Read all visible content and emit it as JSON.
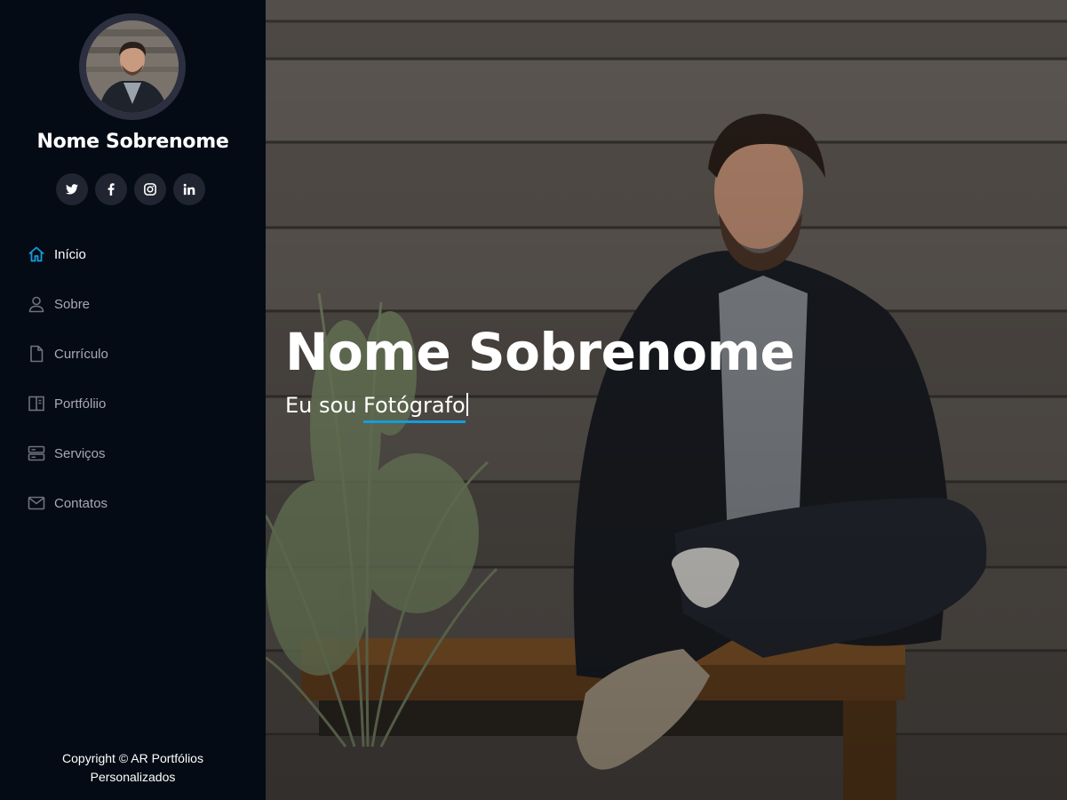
{
  "profile": {
    "name": "Nome Sobrenome"
  },
  "social": [
    {
      "icon": "twitter-icon"
    },
    {
      "icon": "facebook-icon"
    },
    {
      "icon": "instagram-icon"
    },
    {
      "icon": "linkedin-icon"
    }
  ],
  "nav": {
    "items": [
      {
        "label": "Início",
        "icon": "home-icon",
        "active": true
      },
      {
        "label": "Sobre",
        "icon": "person-icon"
      },
      {
        "label": "Currículo",
        "icon": "file-icon"
      },
      {
        "label": "Portfóliio",
        "icon": "book-half-icon"
      },
      {
        "label": "Serviços",
        "icon": "server-icon"
      },
      {
        "label": "Contatos",
        "icon": "envelope-icon"
      }
    ]
  },
  "footer": {
    "line1": "Copyright © AR Portfólios",
    "line2": "Personalizados"
  },
  "hero": {
    "title": "Nome Sobrenome",
    "subtitle_prefix": "Eu sou ",
    "subtitle_typed": "Fotógrafo"
  },
  "colors": {
    "accent": "#149ddd",
    "sidebar_bg": "#040b14",
    "social_bg": "#212431",
    "nav_text": "#a8a9b4"
  }
}
